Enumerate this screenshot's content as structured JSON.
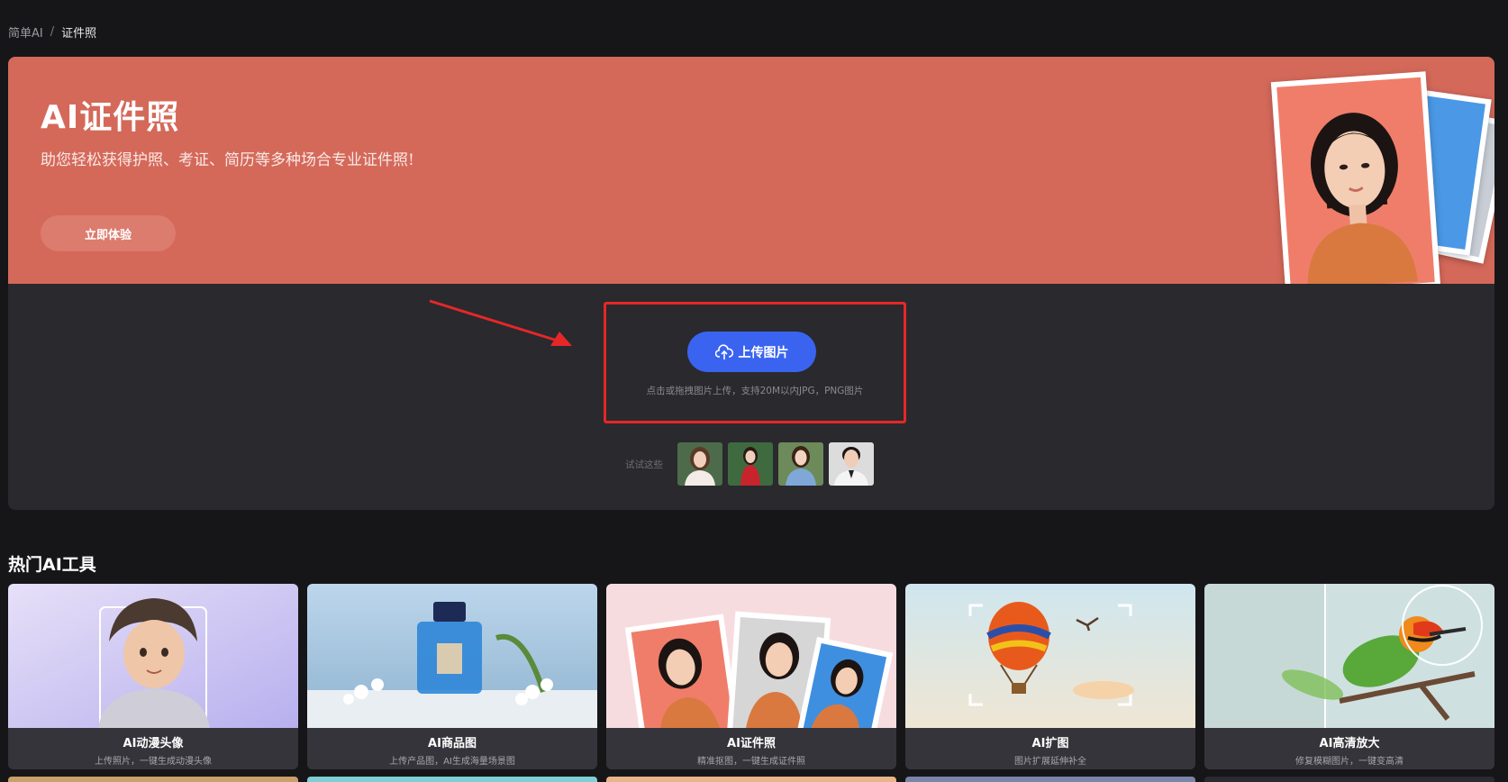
{
  "breadcrumb": {
    "root": "简单AI",
    "separator": "/",
    "current": "证件照"
  },
  "banner": {
    "title": "AI证件照",
    "subtitle": "助您轻松获得护照、考证、简历等多种场合专业证件照!",
    "cta_label": "立即体验",
    "bg_color": "#d4695a"
  },
  "upload": {
    "button_label": "上传图片",
    "hint": "点击或拖拽图片上传，支持20M以内JPG，PNG图片",
    "accent_color": "#3a64f0",
    "icon": "cloud-upload-icon"
  },
  "samples": {
    "label": "试试这些",
    "count": 4
  },
  "hot_tools": {
    "title": "热门AI工具",
    "items": [
      {
        "name": "AI动漫头像",
        "desc": "上传照片，一键生成动漫头像"
      },
      {
        "name": "AI商品图",
        "desc": "上传产品图，AI生成海量场景图"
      },
      {
        "name": "AI证件照",
        "desc": "精准抠图，一键生成证件照"
      },
      {
        "name": "AI扩图",
        "desc": "图片扩展延伸补全"
      },
      {
        "name": "AI高清放大",
        "desc": "修复模糊图片，一键变高清"
      }
    ]
  }
}
